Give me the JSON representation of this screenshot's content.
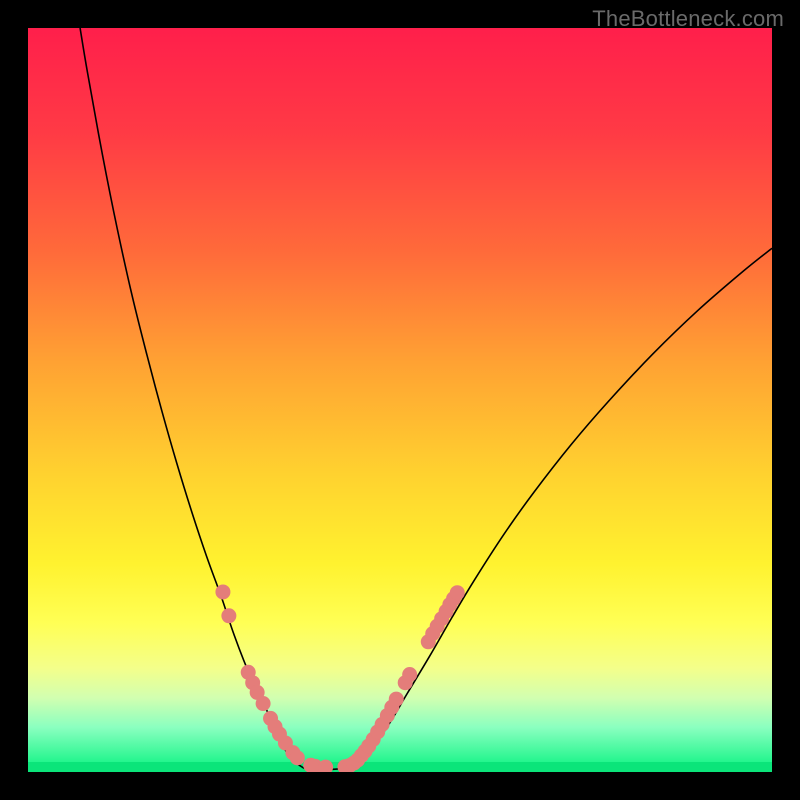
{
  "watermark": {
    "text": "TheBottleneck.com"
  },
  "frame": {
    "border_color": "#000000",
    "border_width_px": 28,
    "outer_w": 800,
    "outer_h": 800
  },
  "plot": {
    "inner_x": 28,
    "inner_y": 28,
    "inner_w": 744,
    "inner_h": 744
  },
  "colors": {
    "gradient_stops": [
      {
        "pos": 0.0,
        "color": "#ff1f4b"
      },
      {
        "pos": 0.14,
        "color": "#ff3a45"
      },
      {
        "pos": 0.3,
        "color": "#ff6a3a"
      },
      {
        "pos": 0.45,
        "color": "#ffa233"
      },
      {
        "pos": 0.6,
        "color": "#ffd22f"
      },
      {
        "pos": 0.72,
        "color": "#fff22f"
      },
      {
        "pos": 0.8,
        "color": "#ffff55"
      },
      {
        "pos": 0.86,
        "color": "#f4ff8a"
      },
      {
        "pos": 0.9,
        "color": "#d2ffb0"
      },
      {
        "pos": 0.94,
        "color": "#8affc0"
      },
      {
        "pos": 0.99,
        "color": "#1cf58a"
      },
      {
        "pos": 1.0,
        "color": "#0be57a"
      }
    ],
    "green_band": {
      "top_frac": 0.986,
      "height_frac": 0.016,
      "color": "#0be57a"
    },
    "curve_stroke": "#000000",
    "dot_fill": "#e47d7a"
  },
  "chart_data": {
    "type": "line",
    "title": "",
    "xlabel": "",
    "ylabel": "",
    "xlim": [
      0,
      100
    ],
    "ylim": [
      0,
      100
    ],
    "legend": false,
    "grid": false,
    "series": [
      {
        "name": "left-branch",
        "x": [
          7,
          8,
          10,
          12,
          14,
          16,
          18,
          20,
          22,
          24,
          26,
          27.5,
          29,
          30.5,
          32,
          33,
          34,
          34.8,
          35.5,
          36.2,
          36.8,
          37.2
        ],
        "y": [
          100,
          94,
          83,
          73,
          64,
          56,
          48.5,
          41.5,
          35,
          29,
          23.5,
          19,
          15,
          11.5,
          8.5,
          6,
          4,
          2.6,
          1.7,
          1.1,
          0.7,
          0.5
        ]
      },
      {
        "name": "valley",
        "x": [
          37.2,
          38.5,
          40,
          41.5,
          43
        ],
        "y": [
          0.5,
          0.35,
          0.35,
          0.4,
          0.6
        ]
      },
      {
        "name": "right-branch",
        "x": [
          43,
          44,
          45.5,
          47,
          49,
          51,
          54,
          57,
          60,
          64,
          68,
          73,
          78,
          84,
          90,
          96,
          100
        ],
        "y": [
          0.6,
          1.2,
          2.4,
          4.2,
          7.2,
          10.6,
          15.6,
          20.8,
          25.8,
          32,
          37.6,
          44,
          49.8,
          56.2,
          62,
          67.2,
          70.4
        ]
      }
    ],
    "dots": {
      "name": "highlight-dots",
      "radius_px": 7.5,
      "points": [
        {
          "x": 26.2,
          "y": 24.2
        },
        {
          "x": 27.0,
          "y": 21.0
        },
        {
          "x": 29.6,
          "y": 13.4
        },
        {
          "x": 30.2,
          "y": 12.0
        },
        {
          "x": 30.8,
          "y": 10.7
        },
        {
          "x": 31.6,
          "y": 9.2
        },
        {
          "x": 32.6,
          "y": 7.2
        },
        {
          "x": 33.2,
          "y": 6.1
        },
        {
          "x": 33.8,
          "y": 5.1
        },
        {
          "x": 34.6,
          "y": 3.9
        },
        {
          "x": 35.6,
          "y": 2.6
        },
        {
          "x": 36.2,
          "y": 1.9
        },
        {
          "x": 38.0,
          "y": 0.9
        },
        {
          "x": 38.6,
          "y": 0.75
        },
        {
          "x": 40.0,
          "y": 0.65
        },
        {
          "x": 42.6,
          "y": 0.7
        },
        {
          "x": 43.2,
          "y": 0.85
        },
        {
          "x": 43.8,
          "y": 1.2
        },
        {
          "x": 44.3,
          "y": 1.6
        },
        {
          "x": 44.8,
          "y": 2.2
        },
        {
          "x": 45.3,
          "y": 2.8
        },
        {
          "x": 45.8,
          "y": 3.5
        },
        {
          "x": 46.4,
          "y": 4.4
        },
        {
          "x": 47.0,
          "y": 5.4
        },
        {
          "x": 47.6,
          "y": 6.4
        },
        {
          "x": 48.3,
          "y": 7.6
        },
        {
          "x": 48.9,
          "y": 8.7
        },
        {
          "x": 49.5,
          "y": 9.8
        },
        {
          "x": 50.7,
          "y": 12.0
        },
        {
          "x": 51.3,
          "y": 13.1
        },
        {
          "x": 53.8,
          "y": 17.5
        },
        {
          "x": 54.4,
          "y": 18.6
        },
        {
          "x": 55.0,
          "y": 19.6
        },
        {
          "x": 55.6,
          "y": 20.6
        },
        {
          "x": 56.2,
          "y": 21.6
        },
        {
          "x": 56.7,
          "y": 22.5
        },
        {
          "x": 57.2,
          "y": 23.3
        },
        {
          "x": 57.7,
          "y": 24.1
        }
      ]
    }
  }
}
